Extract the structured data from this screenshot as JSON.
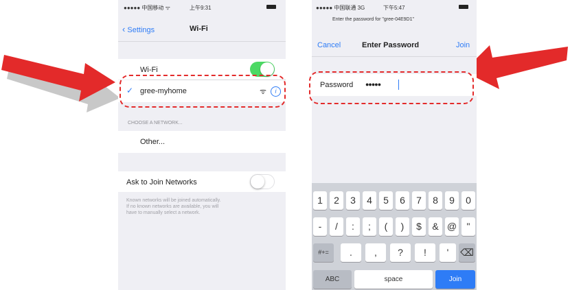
{
  "left_screen": {
    "status_bar": {
      "signal": "●●●●● 中国移动 ᯤ",
      "time": "上午9:31",
      "battery_icon": "battery-icon"
    },
    "nav": {
      "back_label": "Settings",
      "title": "Wi-Fi"
    },
    "wifi_row": {
      "label": "Wi-Fi",
      "toggle_on": true
    },
    "connected_network": {
      "name": "gree-myhome",
      "checked": true
    },
    "section_header": "CHOOSE A NETWORK...",
    "other_label": "Other...",
    "ask_join": {
      "label": "Ask to Join Networks",
      "toggle_on": false
    },
    "ask_join_footer": [
      "Known networks will be joined automatically.",
      "If no known networks are available, you will",
      "have to manually select a network."
    ]
  },
  "right_screen": {
    "status_bar": {
      "signal": "●●●●● 中国联通 3G",
      "time": "下午5:47",
      "battery_icon": "battery-icon"
    },
    "prompt": "Enter the password for \"gree-04E9D1\"",
    "nav": {
      "cancel_label": "Cancel",
      "title": "Enter Password",
      "join_label": "Join"
    },
    "password": {
      "label": "Password",
      "value": "●●●●●"
    },
    "keyboard": {
      "row1": [
        "1",
        "2",
        "3",
        "4",
        "5",
        "6",
        "7",
        "8",
        "9",
        "0"
      ],
      "row2": [
        "-",
        "/",
        ":",
        ";",
        "(",
        ")",
        "$",
        "&",
        "@",
        "\""
      ],
      "row3": [
        "#+=",
        ".",
        ",",
        "?",
        "!",
        "'"
      ],
      "delete_icon": "backspace-icon",
      "abc_label": "ABC",
      "space_label": "space",
      "join_label": "Join"
    }
  },
  "colors": {
    "ios_blue": "#2e7cf6",
    "toggle_green": "#4cd964",
    "annotation_red": "#e32a2a",
    "keyboard_bg": "#cfd2d8"
  }
}
